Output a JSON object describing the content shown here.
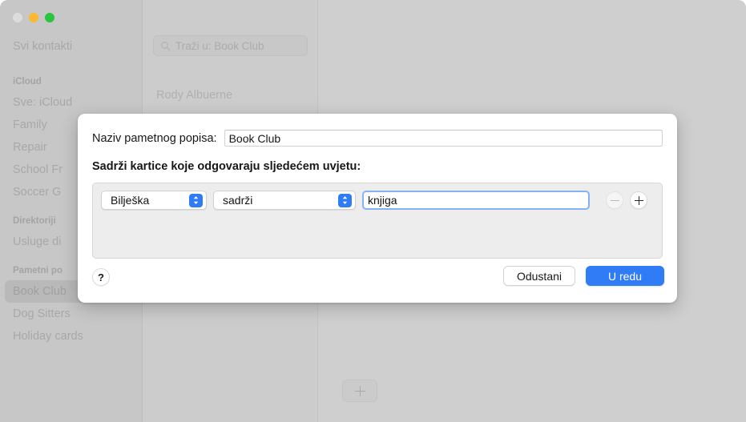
{
  "window": {
    "traffic_lights": [
      "close",
      "minimize",
      "maximize"
    ]
  },
  "sidebar": {
    "all_contacts": "Svi kontakti",
    "groups": [
      {
        "type": "header",
        "label": "iCloud"
      },
      {
        "type": "item",
        "label": "Sve: iCloud"
      },
      {
        "type": "item",
        "label": "Family"
      },
      {
        "type": "item",
        "label": "Repair"
      },
      {
        "type": "item",
        "label": "School Fr"
      },
      {
        "type": "item",
        "label": "Soccer G"
      },
      {
        "type": "header",
        "label": "Direktoriji"
      },
      {
        "type": "item",
        "label": "Usluge di"
      },
      {
        "type": "header",
        "label": "Pametni po"
      },
      {
        "type": "item",
        "label": "Book Club",
        "selected": true
      },
      {
        "type": "item",
        "label": "Dog Sitters"
      },
      {
        "type": "item",
        "label": "Holiday cards"
      }
    ]
  },
  "list_column": {
    "search_placeholder": "Traži u: Book Club",
    "search_icon": "search-icon",
    "contacts": [
      "Rody Albuerne"
    ]
  },
  "detail": {
    "add_button_icon": "plus-icon"
  },
  "sheet": {
    "name_label": "Naziv pametnog popisa:",
    "name_value": "Book Club",
    "condition_label": "Sadrži kartice koje odgovaraju sljedećem uvjetu:",
    "condition": {
      "field_popup": "Bilješka",
      "operator_popup": "sadrži",
      "value": "knjiga",
      "remove_icon": "minus-icon",
      "add_icon": "plus-icon"
    },
    "help_label": "?",
    "cancel_label": "Odustani",
    "ok_label": "U redu"
  },
  "colors": {
    "accent": "#2f7cf6",
    "focus_ring": "#86b1f5",
    "window_bg": "#cfcfcf",
    "sidebar_bg": "#c7c7c7",
    "sheet_bg": "#ffffff",
    "panel_bg": "#ededed"
  }
}
